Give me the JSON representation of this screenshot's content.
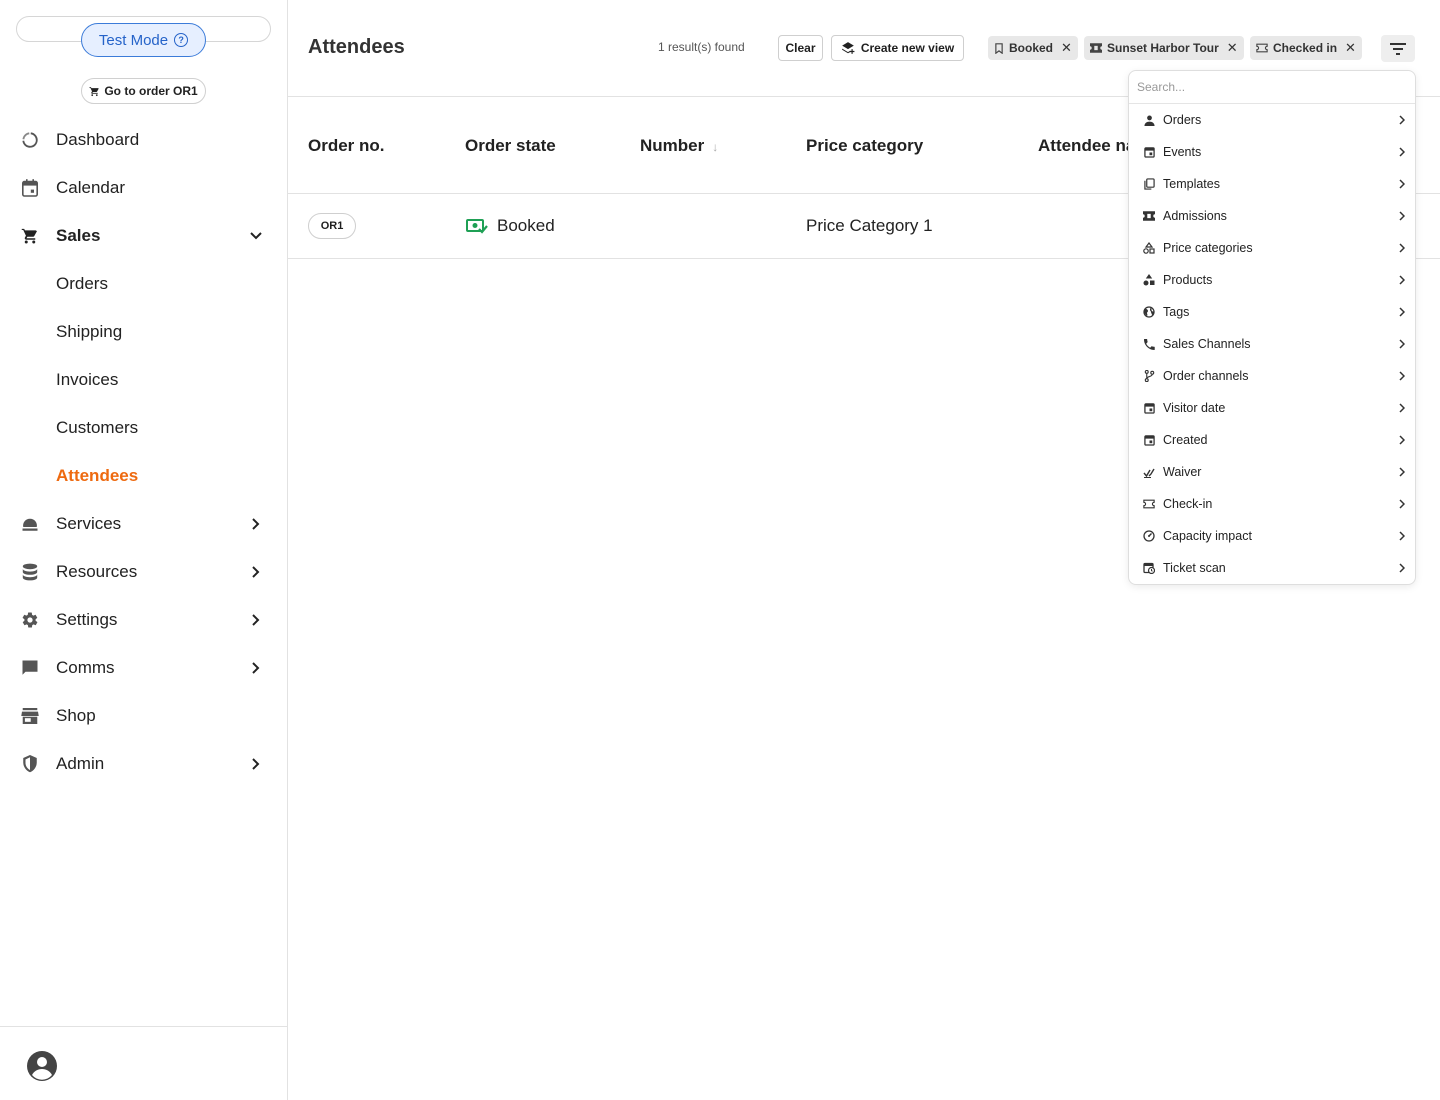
{
  "sidebar": {
    "test_mode_label": "Test Mode",
    "goto_order_label": "Go to order OR1",
    "items": [
      {
        "label": "Dashboard",
        "icon": "dashboard-icon"
      },
      {
        "label": "Calendar",
        "icon": "calendar-icon"
      },
      {
        "label": "Sales",
        "icon": "cart-icon",
        "expanded": true
      },
      {
        "label": "Orders"
      },
      {
        "label": "Shipping"
      },
      {
        "label": "Invoices"
      },
      {
        "label": "Customers"
      },
      {
        "label": "Attendees",
        "active": true
      },
      {
        "label": "Services",
        "icon": "services-icon"
      },
      {
        "label": "Resources",
        "icon": "database-icon"
      },
      {
        "label": "Settings",
        "icon": "gear-icon"
      },
      {
        "label": "Comms",
        "icon": "chat-icon"
      },
      {
        "label": "Shop",
        "icon": "store-icon"
      },
      {
        "label": "Admin",
        "icon": "shield-icon"
      }
    ]
  },
  "header": {
    "title": "Attendees",
    "results": "1 result(s) found",
    "clear_label": "Clear",
    "create_view_label": "Create new view",
    "chips": [
      {
        "label": "Booked",
        "icon": "bookmark-icon"
      },
      {
        "label": "Sunset Harbor Tour",
        "icon": "ticket-icon"
      },
      {
        "label": "Checked in",
        "icon": "checkin-icon"
      }
    ]
  },
  "table": {
    "columns": [
      "Order no.",
      "Order state",
      "Number",
      "Price category",
      "Attendee na"
    ],
    "sort_glyph": "↓",
    "rows": [
      {
        "order_no": "OR1",
        "state": "Booked",
        "number": "",
        "price_category": "Price Category 1"
      }
    ]
  },
  "dropdown": {
    "search_placeholder": "Search...",
    "items": [
      "Orders",
      "Events",
      "Templates",
      "Admissions",
      "Price categories",
      "Products",
      "Tags",
      "Sales Channels",
      "Order channels",
      "Visitor date",
      "Created",
      "Waiver",
      "Check-in",
      "Capacity impact",
      "Ticket scan"
    ]
  },
  "colors": {
    "accent_active": "#ee6a10",
    "test_mode_blue": "#2563c9",
    "booked_green": "#1fa055"
  }
}
